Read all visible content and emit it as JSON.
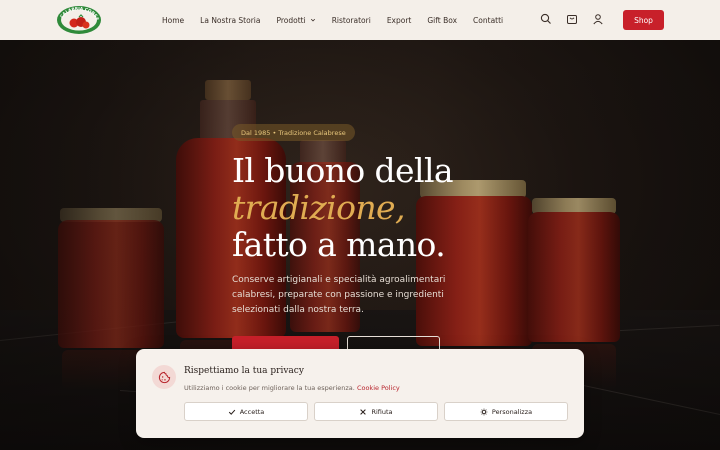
{
  "header": {
    "logo_text": "CALABRIA CONSERVE",
    "nav": [
      {
        "label": "Home"
      },
      {
        "label": "La Nostra Storia"
      },
      {
        "label": "Prodotti"
      },
      {
        "label": "Ristoratori"
      },
      {
        "label": "Export"
      },
      {
        "label": "Gift Box"
      },
      {
        "label": "Contatti"
      }
    ],
    "icons": [
      "search-icon",
      "cart-icon",
      "user-icon"
    ],
    "shop_label": "Shop"
  },
  "hero": {
    "badge": "Dal 1985 • Tradizione Calabrese",
    "title_line1": "Il buono della",
    "title_line2": "tradizione,",
    "title_line3": "fatto a mano.",
    "description": "Conserve artigianali e specialità agroalimentari calabresi, preparate con passione e ingredienti selezionati dalla nostra terra."
  },
  "cookie": {
    "title": "Rispettiamo la tua privacy",
    "text": "Utilizziamo i cookie per migliorare la tua esperienza.",
    "link": "Cookie Policy",
    "accept": "Accetta",
    "reject": "Rifiuta",
    "customize": "Personalizza"
  },
  "colors": {
    "brand_red": "#c8202a",
    "gold": "#e0ac52",
    "header_bg": "#f4efe9"
  }
}
